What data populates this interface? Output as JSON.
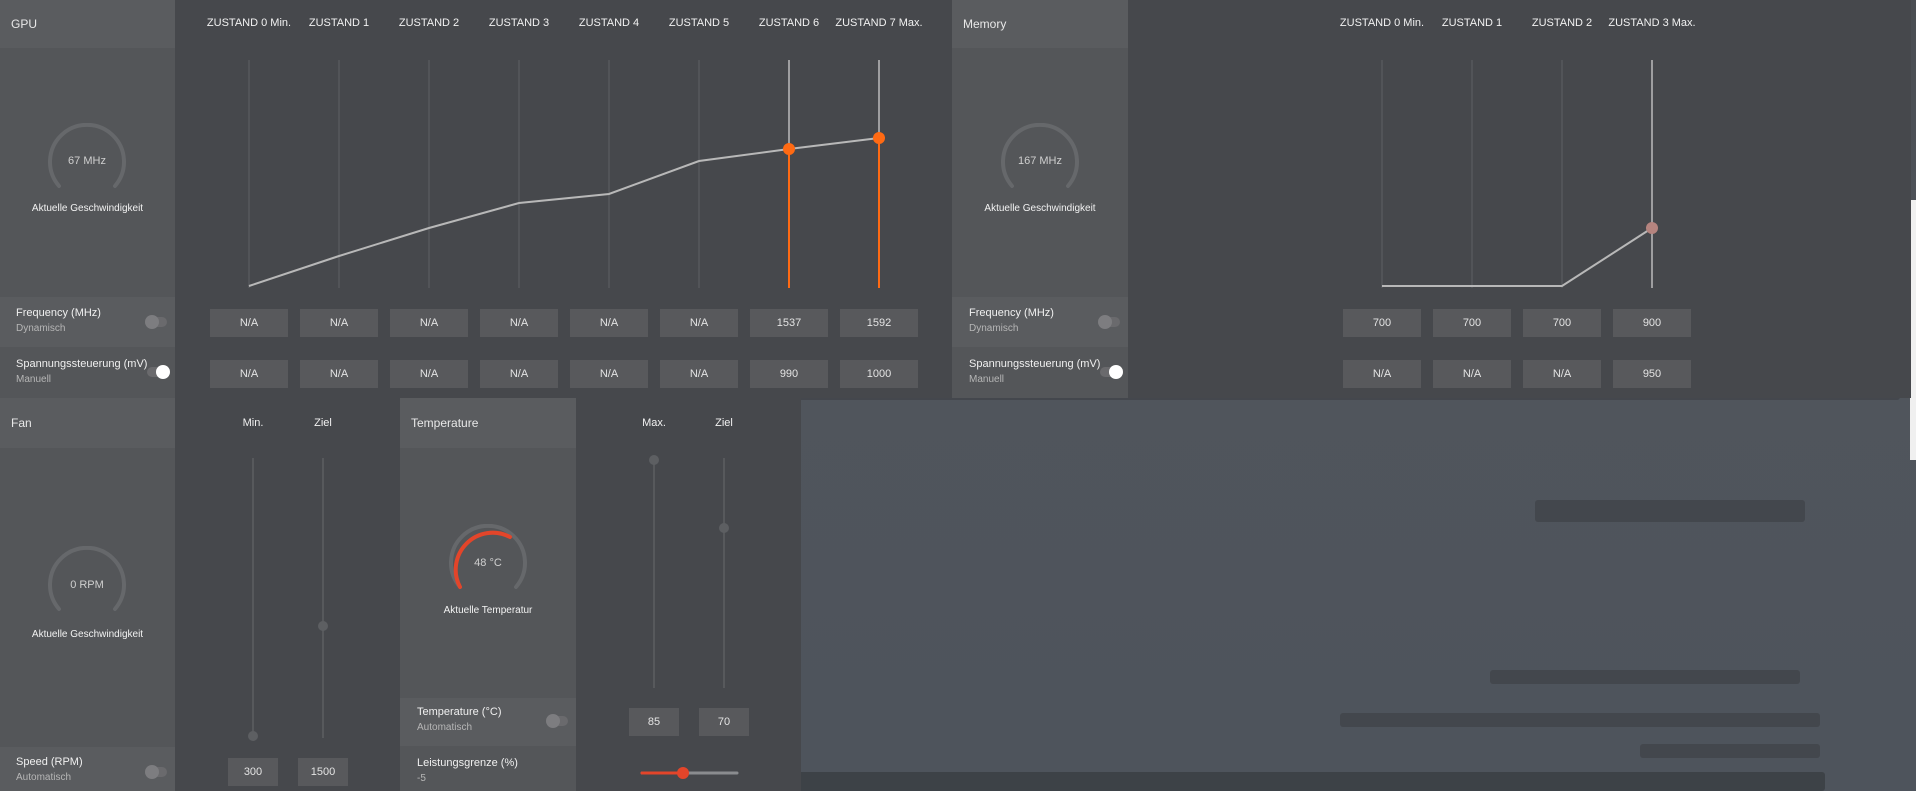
{
  "gpu": {
    "title": "GPU",
    "states": [
      "ZUSTAND 0 Min.",
      "ZUSTAND 1",
      "ZUSTAND 2",
      "ZUSTAND 3",
      "ZUSTAND 4",
      "ZUSTAND 5",
      "ZUSTAND 6",
      "ZUSTAND 7 Max."
    ],
    "gauge": {
      "value": "67 MHz",
      "label": "Aktuelle Geschwindigkeit"
    },
    "frequency": {
      "label": "Frequency (MHz)",
      "mode": "Dynamisch",
      "values": [
        "N/A",
        "N/A",
        "N/A",
        "N/A",
        "N/A",
        "N/A",
        "1537",
        "1592"
      ]
    },
    "voltage": {
      "label": "Spannungssteuerung (mV)",
      "mode": "Manuell",
      "values": [
        "N/A",
        "N/A",
        "N/A",
        "N/A",
        "N/A",
        "N/A",
        "990",
        "1000"
      ]
    }
  },
  "memory": {
    "title": "Memory",
    "states": [
      "ZUSTAND 0 Min.",
      "ZUSTAND 1",
      "ZUSTAND 2",
      "ZUSTAND 3 Max."
    ],
    "gauge": {
      "value": "167 MHz",
      "label": "Aktuelle Geschwindigkeit"
    },
    "frequency": {
      "label": "Frequency (MHz)",
      "mode": "Dynamisch",
      "values": [
        "700",
        "700",
        "700",
        "900"
      ]
    },
    "voltage": {
      "label": "Spannungssteuerung (mV)",
      "mode": "Manuell",
      "values": [
        "N/A",
        "N/A",
        "N/A",
        "950"
      ]
    }
  },
  "fan": {
    "title": "Fan",
    "col_min": "Min.",
    "col_target": "Ziel",
    "gauge": {
      "value": "0 RPM",
      "label": "Aktuelle Geschwindigkeit"
    },
    "speed": {
      "label": "Speed (RPM)",
      "mode": "Automatisch",
      "min": "300",
      "target": "1500"
    }
  },
  "temperature": {
    "title": "Temperature",
    "col_max": "Max.",
    "col_target": "Ziel",
    "gauge": {
      "value": "48 °C",
      "label": "Aktuelle Temperatur"
    },
    "temp": {
      "label": "Temperature (°C)",
      "mode": "Automatisch",
      "max": "85",
      "target": "70"
    },
    "power_limit": {
      "label": "Leistungsgrenze (%)",
      "value": "-5"
    }
  },
  "colors": {
    "accent": "#ff6a13",
    "gauge_red": "#e3452a",
    "memory_point": "#b5847f"
  }
}
